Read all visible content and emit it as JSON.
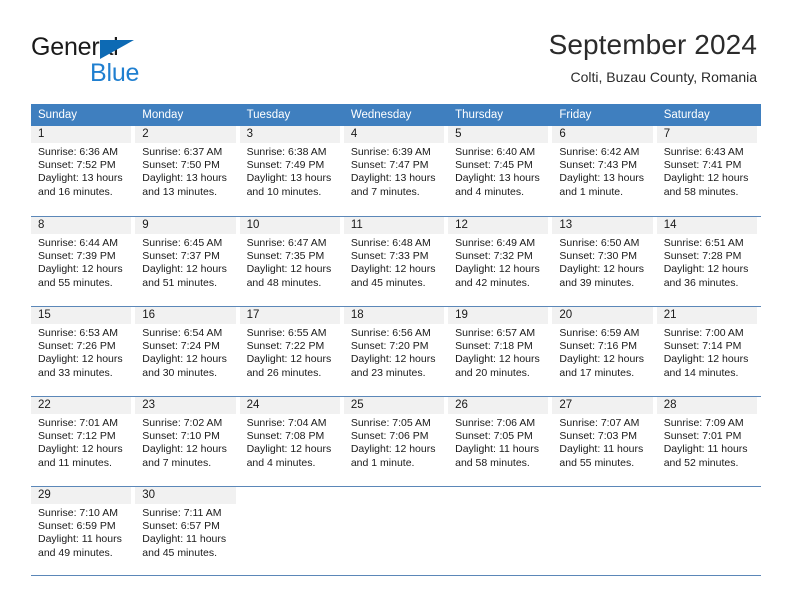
{
  "logo": {
    "word_one": "General",
    "word_two": "Blue",
    "triangle_color": "#0d6ab4",
    "blue_color": "#1f7fd0"
  },
  "header": {
    "title": "September 2024",
    "subtitle": "Colti, Buzau County, Romania"
  },
  "calendar": {
    "header_color": "#3f7fbf",
    "weekdays": [
      "Sunday",
      "Monday",
      "Tuesday",
      "Wednesday",
      "Thursday",
      "Friday",
      "Saturday"
    ],
    "weeks": [
      [
        {
          "day": "1",
          "sunrise": "Sunrise: 6:36 AM",
          "sunset": "Sunset: 7:52 PM",
          "daylight": "Daylight: 13 hours and 16 minutes."
        },
        {
          "day": "2",
          "sunrise": "Sunrise: 6:37 AM",
          "sunset": "Sunset: 7:50 PM",
          "daylight": "Daylight: 13 hours and 13 minutes."
        },
        {
          "day": "3",
          "sunrise": "Sunrise: 6:38 AM",
          "sunset": "Sunset: 7:49 PM",
          "daylight": "Daylight: 13 hours and 10 minutes."
        },
        {
          "day": "4",
          "sunrise": "Sunrise: 6:39 AM",
          "sunset": "Sunset: 7:47 PM",
          "daylight": "Daylight: 13 hours and 7 minutes."
        },
        {
          "day": "5",
          "sunrise": "Sunrise: 6:40 AM",
          "sunset": "Sunset: 7:45 PM",
          "daylight": "Daylight: 13 hours and 4 minutes."
        },
        {
          "day": "6",
          "sunrise": "Sunrise: 6:42 AM",
          "sunset": "Sunset: 7:43 PM",
          "daylight": "Daylight: 13 hours and 1 minute."
        },
        {
          "day": "7",
          "sunrise": "Sunrise: 6:43 AM",
          "sunset": "Sunset: 7:41 PM",
          "daylight": "Daylight: 12 hours and 58 minutes."
        }
      ],
      [
        {
          "day": "8",
          "sunrise": "Sunrise: 6:44 AM",
          "sunset": "Sunset: 7:39 PM",
          "daylight": "Daylight: 12 hours and 55 minutes."
        },
        {
          "day": "9",
          "sunrise": "Sunrise: 6:45 AM",
          "sunset": "Sunset: 7:37 PM",
          "daylight": "Daylight: 12 hours and 51 minutes."
        },
        {
          "day": "10",
          "sunrise": "Sunrise: 6:47 AM",
          "sunset": "Sunset: 7:35 PM",
          "daylight": "Daylight: 12 hours and 48 minutes."
        },
        {
          "day": "11",
          "sunrise": "Sunrise: 6:48 AM",
          "sunset": "Sunset: 7:33 PM",
          "daylight": "Daylight: 12 hours and 45 minutes."
        },
        {
          "day": "12",
          "sunrise": "Sunrise: 6:49 AM",
          "sunset": "Sunset: 7:32 PM",
          "daylight": "Daylight: 12 hours and 42 minutes."
        },
        {
          "day": "13",
          "sunrise": "Sunrise: 6:50 AM",
          "sunset": "Sunset: 7:30 PM",
          "daylight": "Daylight: 12 hours and 39 minutes."
        },
        {
          "day": "14",
          "sunrise": "Sunrise: 6:51 AM",
          "sunset": "Sunset: 7:28 PM",
          "daylight": "Daylight: 12 hours and 36 minutes."
        }
      ],
      [
        {
          "day": "15",
          "sunrise": "Sunrise: 6:53 AM",
          "sunset": "Sunset: 7:26 PM",
          "daylight": "Daylight: 12 hours and 33 minutes."
        },
        {
          "day": "16",
          "sunrise": "Sunrise: 6:54 AM",
          "sunset": "Sunset: 7:24 PM",
          "daylight": "Daylight: 12 hours and 30 minutes."
        },
        {
          "day": "17",
          "sunrise": "Sunrise: 6:55 AM",
          "sunset": "Sunset: 7:22 PM",
          "daylight": "Daylight: 12 hours and 26 minutes."
        },
        {
          "day": "18",
          "sunrise": "Sunrise: 6:56 AM",
          "sunset": "Sunset: 7:20 PM",
          "daylight": "Daylight: 12 hours and 23 minutes."
        },
        {
          "day": "19",
          "sunrise": "Sunrise: 6:57 AM",
          "sunset": "Sunset: 7:18 PM",
          "daylight": "Daylight: 12 hours and 20 minutes."
        },
        {
          "day": "20",
          "sunrise": "Sunrise: 6:59 AM",
          "sunset": "Sunset: 7:16 PM",
          "daylight": "Daylight: 12 hours and 17 minutes."
        },
        {
          "day": "21",
          "sunrise": "Sunrise: 7:00 AM",
          "sunset": "Sunset: 7:14 PM",
          "daylight": "Daylight: 12 hours and 14 minutes."
        }
      ],
      [
        {
          "day": "22",
          "sunrise": "Sunrise: 7:01 AM",
          "sunset": "Sunset: 7:12 PM",
          "daylight": "Daylight: 12 hours and 11 minutes."
        },
        {
          "day": "23",
          "sunrise": "Sunrise: 7:02 AM",
          "sunset": "Sunset: 7:10 PM",
          "daylight": "Daylight: 12 hours and 7 minutes."
        },
        {
          "day": "24",
          "sunrise": "Sunrise: 7:04 AM",
          "sunset": "Sunset: 7:08 PM",
          "daylight": "Daylight: 12 hours and 4 minutes."
        },
        {
          "day": "25",
          "sunrise": "Sunrise: 7:05 AM",
          "sunset": "Sunset: 7:06 PM",
          "daylight": "Daylight: 12 hours and 1 minute."
        },
        {
          "day": "26",
          "sunrise": "Sunrise: 7:06 AM",
          "sunset": "Sunset: 7:05 PM",
          "daylight": "Daylight: 11 hours and 58 minutes."
        },
        {
          "day": "27",
          "sunrise": "Sunrise: 7:07 AM",
          "sunset": "Sunset: 7:03 PM",
          "daylight": "Daylight: 11 hours and 55 minutes."
        },
        {
          "day": "28",
          "sunrise": "Sunrise: 7:09 AM",
          "sunset": "Sunset: 7:01 PM",
          "daylight": "Daylight: 11 hours and 52 minutes."
        }
      ],
      [
        {
          "day": "29",
          "sunrise": "Sunrise: 7:10 AM",
          "sunset": "Sunset: 6:59 PM",
          "daylight": "Daylight: 11 hours and 49 minutes."
        },
        {
          "day": "30",
          "sunrise": "Sunrise: 7:11 AM",
          "sunset": "Sunset: 6:57 PM",
          "daylight": "Daylight: 11 hours and 45 minutes."
        },
        {
          "day": "",
          "sunrise": "",
          "sunset": "",
          "daylight": ""
        },
        {
          "day": "",
          "sunrise": "",
          "sunset": "",
          "daylight": ""
        },
        {
          "day": "",
          "sunrise": "",
          "sunset": "",
          "daylight": ""
        },
        {
          "day": "",
          "sunrise": "",
          "sunset": "",
          "daylight": ""
        },
        {
          "day": "",
          "sunrise": "",
          "sunset": "",
          "daylight": ""
        }
      ]
    ]
  }
}
